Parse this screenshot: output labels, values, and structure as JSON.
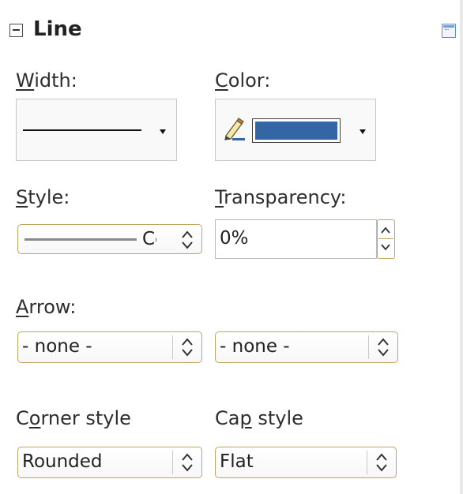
{
  "panel": {
    "title": "Line",
    "icons": {
      "collapse": "collapse-minus-icon",
      "more_options": "more-options-icon",
      "pencil": "pencil-icon",
      "dropdown": "triangle-down-icon",
      "spin": "up-down-chevrons-icon"
    }
  },
  "width": {
    "label": "Width:",
    "mnemonic": "W",
    "rest": "idth:"
  },
  "color": {
    "label": "Color:",
    "mnemonic": "C",
    "rest": "olor:",
    "value_hex": "#3465a4"
  },
  "style": {
    "label": "Style:",
    "mnemonic": "S",
    "rest": "tyle:",
    "value": "Cc"
  },
  "transparency": {
    "label": "Transparency:",
    "mnemonic": "T",
    "rest": "ransparency:",
    "value": "0%"
  },
  "arrow": {
    "label": "Arrow:",
    "mnemonic": "A",
    "rest": "rrow:",
    "start": "- none -",
    "end": "- none -"
  },
  "corner_style": {
    "label": "Corner style",
    "before": "C",
    "mnemonic": "o",
    "rest": "rner style",
    "value": "Rounded"
  },
  "cap_style": {
    "label": "Cap style",
    "before": "Ca",
    "mnemonic": "p",
    "rest": " style",
    "value": "Flat"
  },
  "colors": {
    "accent_border": "#c1a45f",
    "swatch": "#3465a4",
    "header_icon": "#5b8ed0"
  }
}
